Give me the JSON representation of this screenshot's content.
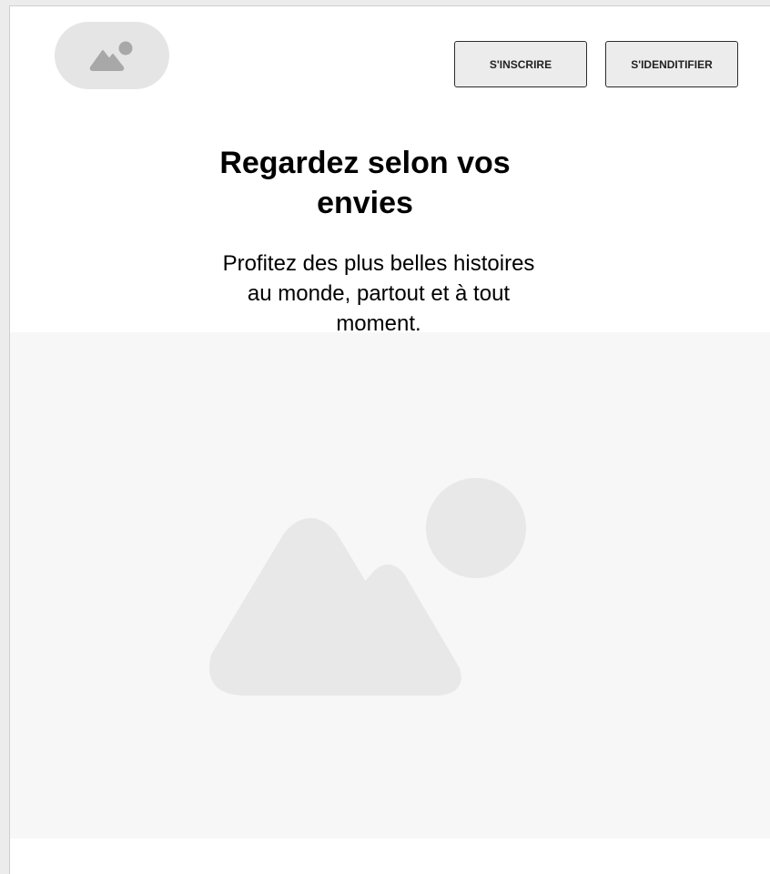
{
  "header": {
    "logo_icon": "image-placeholder-icon",
    "signup_label": "S'INSCRIRE",
    "login_label": "S'IDENDITIFIER"
  },
  "hero": {
    "title": "Regardez selon vos envies",
    "subtitle": "Profitez des plus belles histoires au monde, partout et à tout moment.",
    "image_icon": "image-placeholder-icon"
  },
  "colors": {
    "placeholder_fill": "#e8e8e8",
    "placeholder_icon": "#a8a8a8",
    "hero_background": "#f7f7f7",
    "button_background": "#ececec",
    "button_border": "#2d2d2d"
  }
}
